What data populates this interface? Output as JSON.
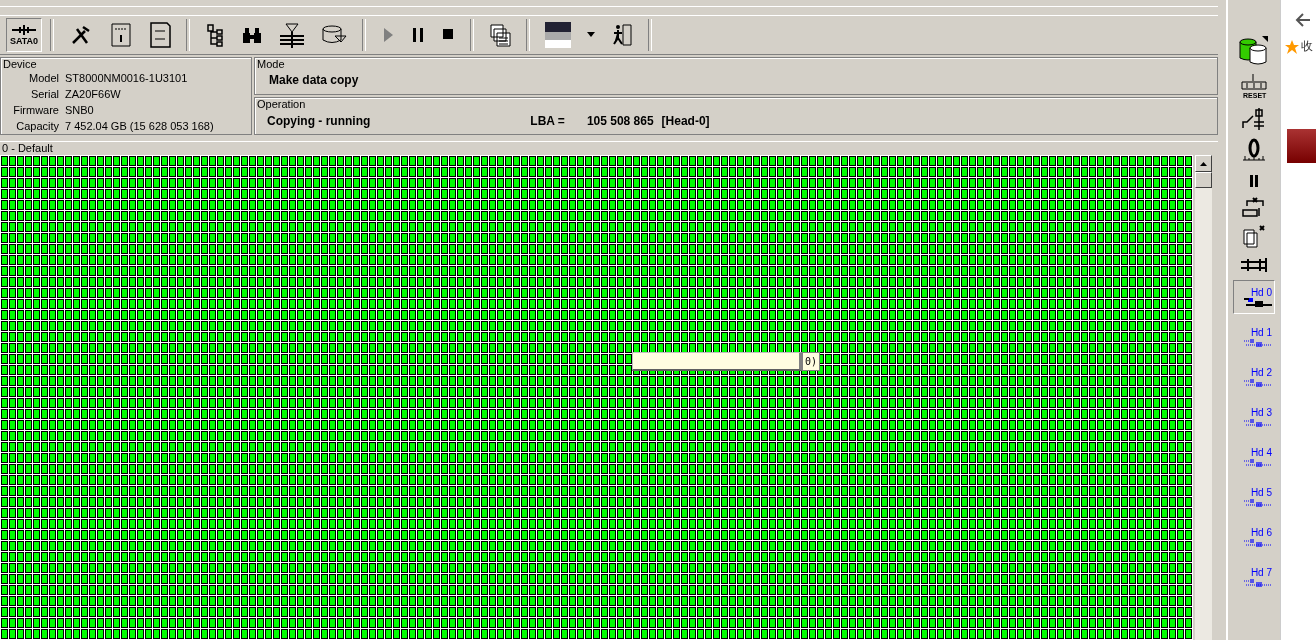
{
  "toolbar": {
    "port_label": "SATA0"
  },
  "device": {
    "title": "Device",
    "fields": [
      {
        "label": "Model",
        "value": "ST8000NM0016-1U3101"
      },
      {
        "label": "Serial",
        "value": "ZA20F66W"
      },
      {
        "label": "Firmware",
        "value": "SNB0"
      },
      {
        "label": "Capacity",
        "value": "7 452.04 GB (15 628 053 168)"
      }
    ]
  },
  "mode": {
    "title": "Mode",
    "value": "Make data copy"
  },
  "operation": {
    "title": "Operation",
    "status": "Copying - running",
    "lba_label": "LBA =",
    "lba_value": "105 508 865",
    "head": "[Head-0]"
  },
  "map": {
    "title": "0 - Default",
    "popup_text": "0)"
  },
  "heads": [
    {
      "label": "Hd 0",
      "selected": true
    },
    {
      "label": "Hd 1",
      "selected": false
    },
    {
      "label": "Hd 2",
      "selected": false
    },
    {
      "label": "Hd 3",
      "selected": false
    },
    {
      "label": "Hd 4",
      "selected": false
    },
    {
      "label": "Hd 5",
      "selected": false
    },
    {
      "label": "Hd 6",
      "selected": false
    },
    {
      "label": "Hd 7",
      "selected": false
    }
  ],
  "browser": {
    "favorites_label": "收"
  },
  "side_toolbar": {
    "reset_label": "RESET"
  }
}
